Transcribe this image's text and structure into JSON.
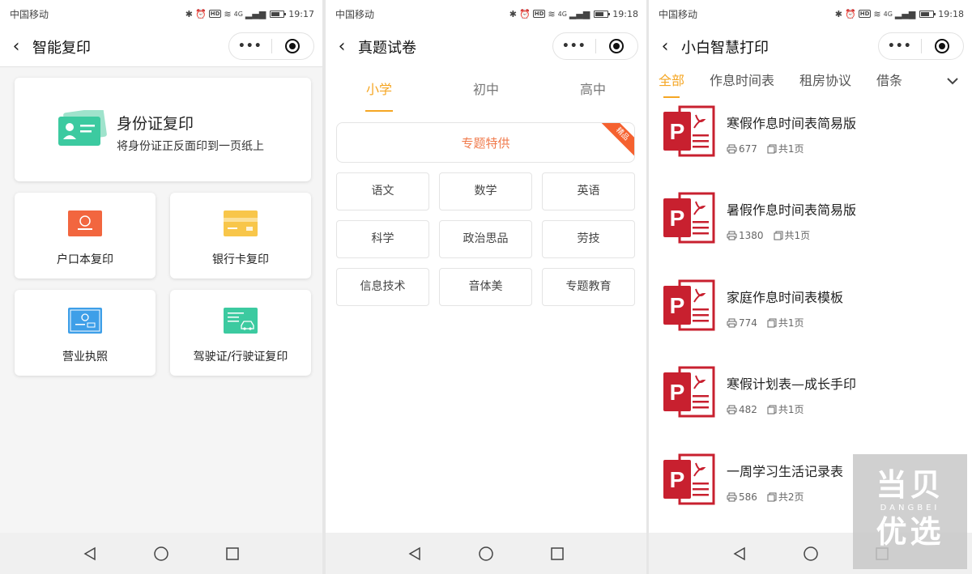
{
  "colors": {
    "accent": "#f5a623",
    "special_text": "#f07b4d",
    "ribbon": "#f5612f",
    "pdf_red": "#c8202f"
  },
  "screens": [
    {
      "status": {
        "carrier": "中国移动",
        "signal": "4G",
        "time": "19:17"
      },
      "nav": {
        "title": "智能复印"
      },
      "main_card": {
        "title": "身份证复印",
        "subtitle": "将身份证正反面印到一页纸上",
        "icon": "id-card-icon"
      },
      "cards": [
        {
          "label": "户口本复印",
          "icon": "household-register-icon",
          "color": "#f2663f"
        },
        {
          "label": "银行卡复印",
          "icon": "bank-card-icon",
          "color": "#f8c64a"
        },
        {
          "label": "营业执照",
          "icon": "business-license-icon",
          "color": "#3e9fe8"
        },
        {
          "label": "驾驶证/行驶证复印",
          "icon": "driver-license-icon",
          "color": "#3ccaa0"
        }
      ]
    },
    {
      "status": {
        "carrier": "中国移动",
        "signal": "4G",
        "time": "19:18"
      },
      "nav": {
        "title": "真题试卷"
      },
      "tabs": [
        "小学",
        "初中",
        "高中"
      ],
      "special": {
        "label": "专题特供",
        "badge": "精品"
      },
      "subjects": [
        "语文",
        "数学",
        "英语",
        "科学",
        "政治思品",
        "劳技",
        "信息技术",
        "音体美",
        "专题教育"
      ]
    },
    {
      "status": {
        "carrier": "中国移动",
        "signal": "4G",
        "time": "19:18"
      },
      "nav": {
        "title": "小白智慧打印"
      },
      "tabs": [
        "全部",
        "作息时间表",
        "租房协议",
        "借条"
      ],
      "docs": [
        {
          "title": "寒假作息时间表简易版",
          "prints": "677",
          "pages": "共1页"
        },
        {
          "title": "暑假作息时间表简易版",
          "prints": "1380",
          "pages": "共1页"
        },
        {
          "title": "家庭作息时间表模板",
          "prints": "774",
          "pages": "共1页"
        },
        {
          "title": "寒假计划表—成长手印",
          "prints": "482",
          "pages": "共1页"
        },
        {
          "title": "一周学习生活记录表",
          "prints": "586",
          "pages": "共2页"
        }
      ]
    }
  ],
  "watermark": {
    "text": "当贝",
    "sub": "DANGBEI",
    "text2": "优选"
  }
}
